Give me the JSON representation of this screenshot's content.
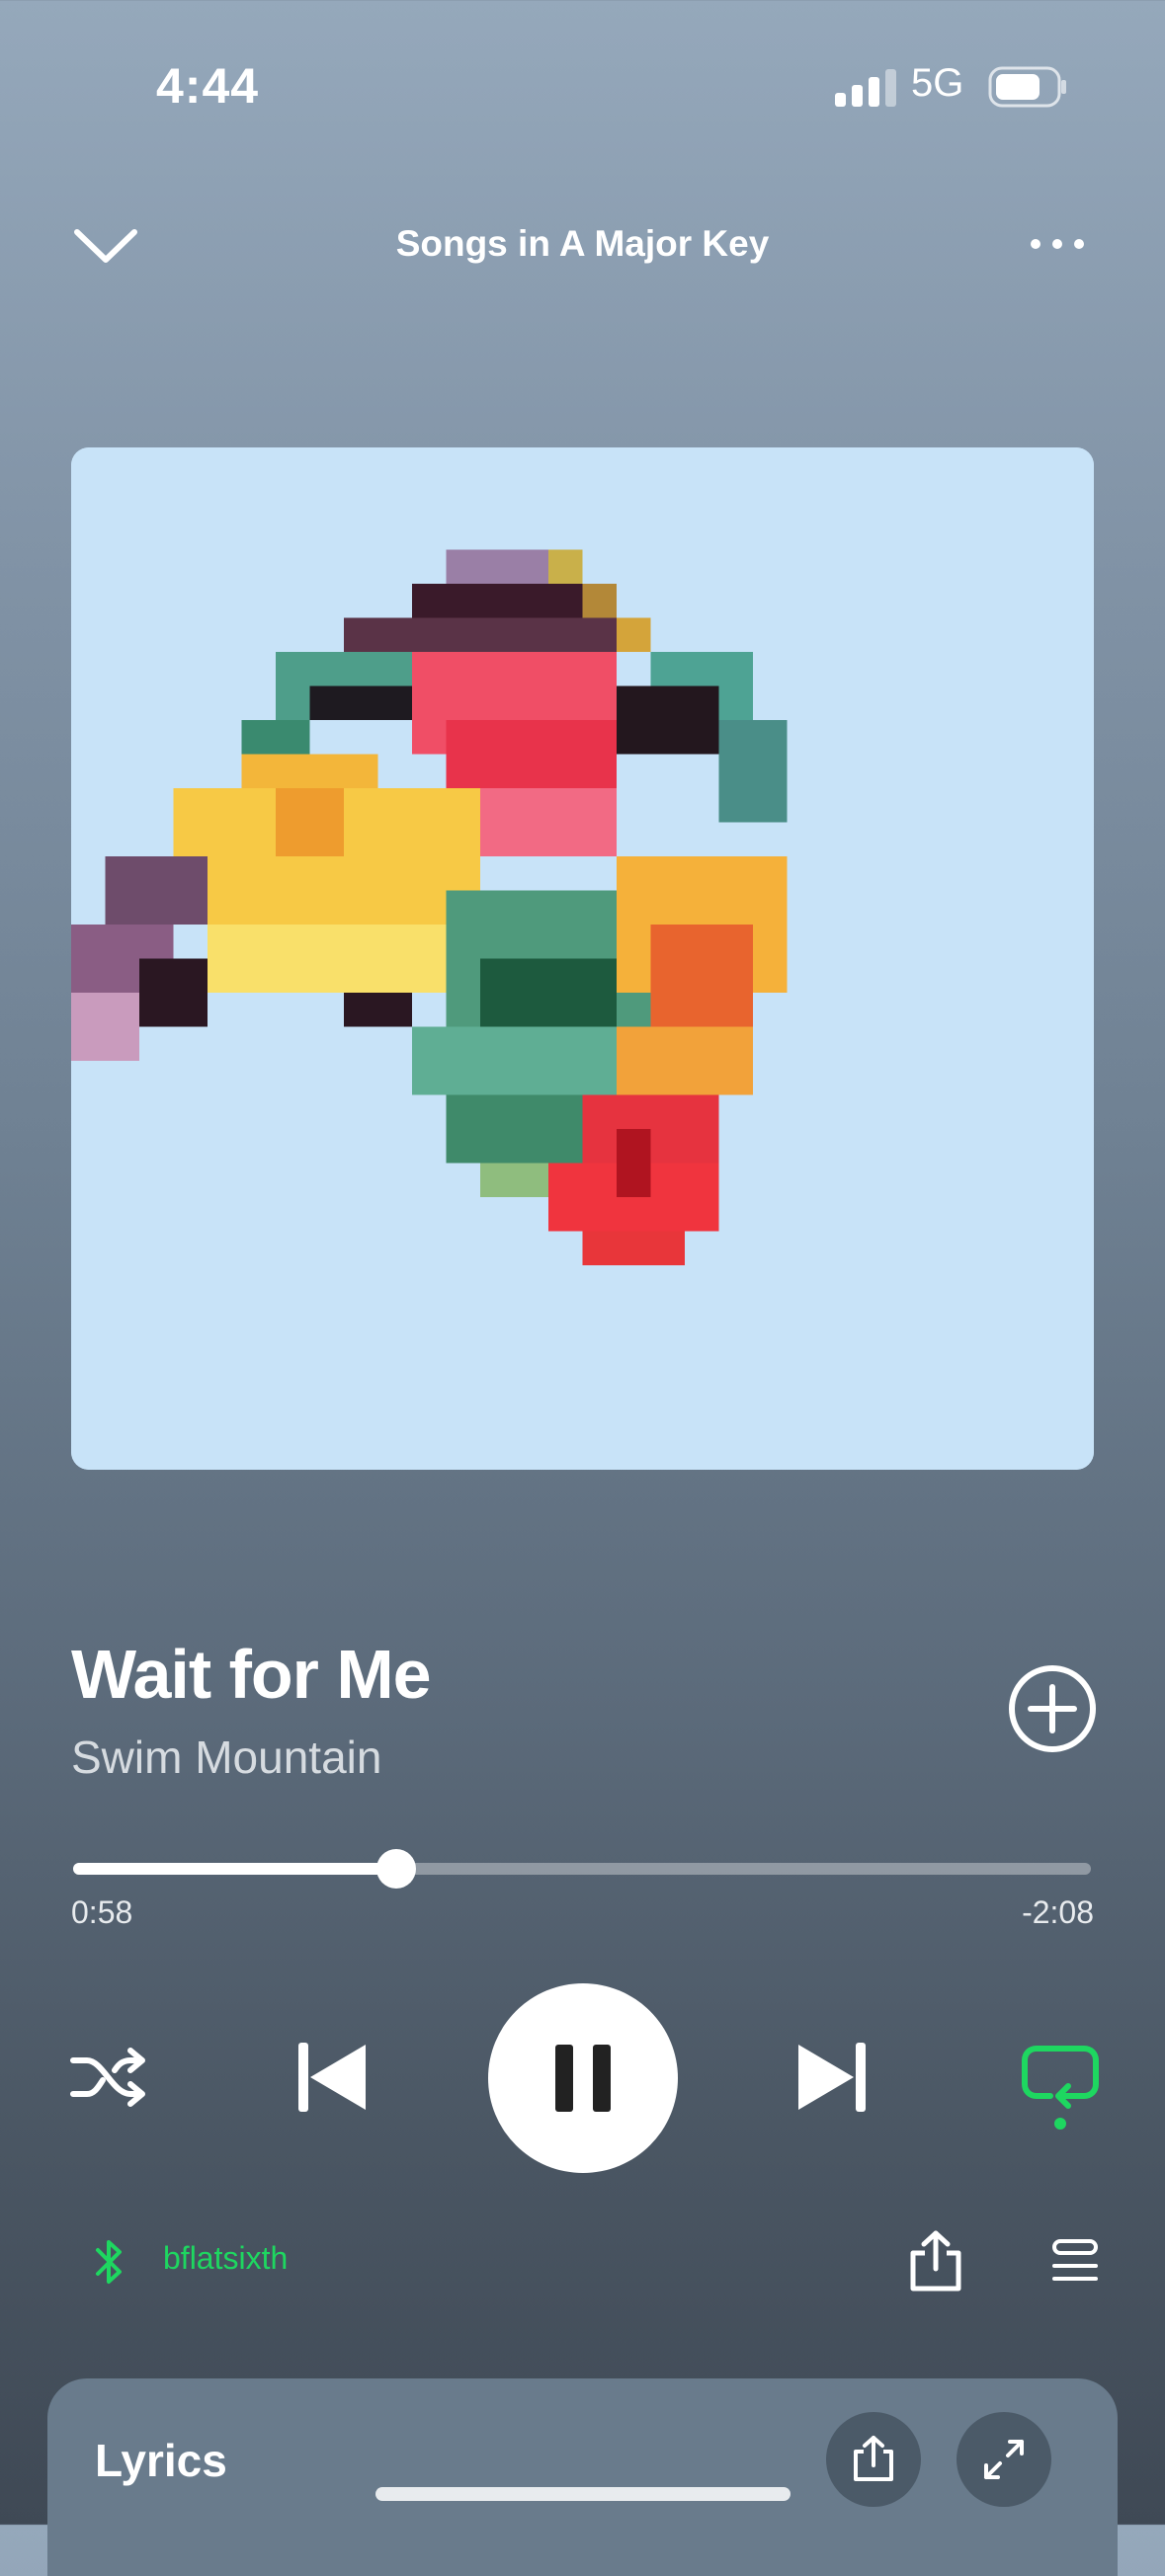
{
  "status_bar": {
    "time": "4:44",
    "network": "5G",
    "battery_percent": 70
  },
  "topbar": {
    "title": "Songs in A Major Key",
    "collapse_icon": "chevron-down-icon",
    "more_icon": "more-horizontal-icon"
  },
  "track": {
    "title": "Wait for Me",
    "artist": "Swim Mountain"
  },
  "progress": {
    "elapsed": "0:58",
    "remaining": "-2:08",
    "fraction": 0.317
  },
  "controls": {
    "shuffle_icon": "shuffle-icon",
    "previous_icon": "skip-previous-icon",
    "play_pause_icon": "pause-icon",
    "next_icon": "skip-next-icon",
    "repeat_icon": "repeat-icon",
    "repeat_active": true
  },
  "device": {
    "name": "bflatsixth",
    "icon": "bluetooth-icon"
  },
  "lyrics": {
    "title": "Lyrics"
  },
  "colors": {
    "accent": "#1ed760",
    "art_background": "#c8e3f8"
  }
}
